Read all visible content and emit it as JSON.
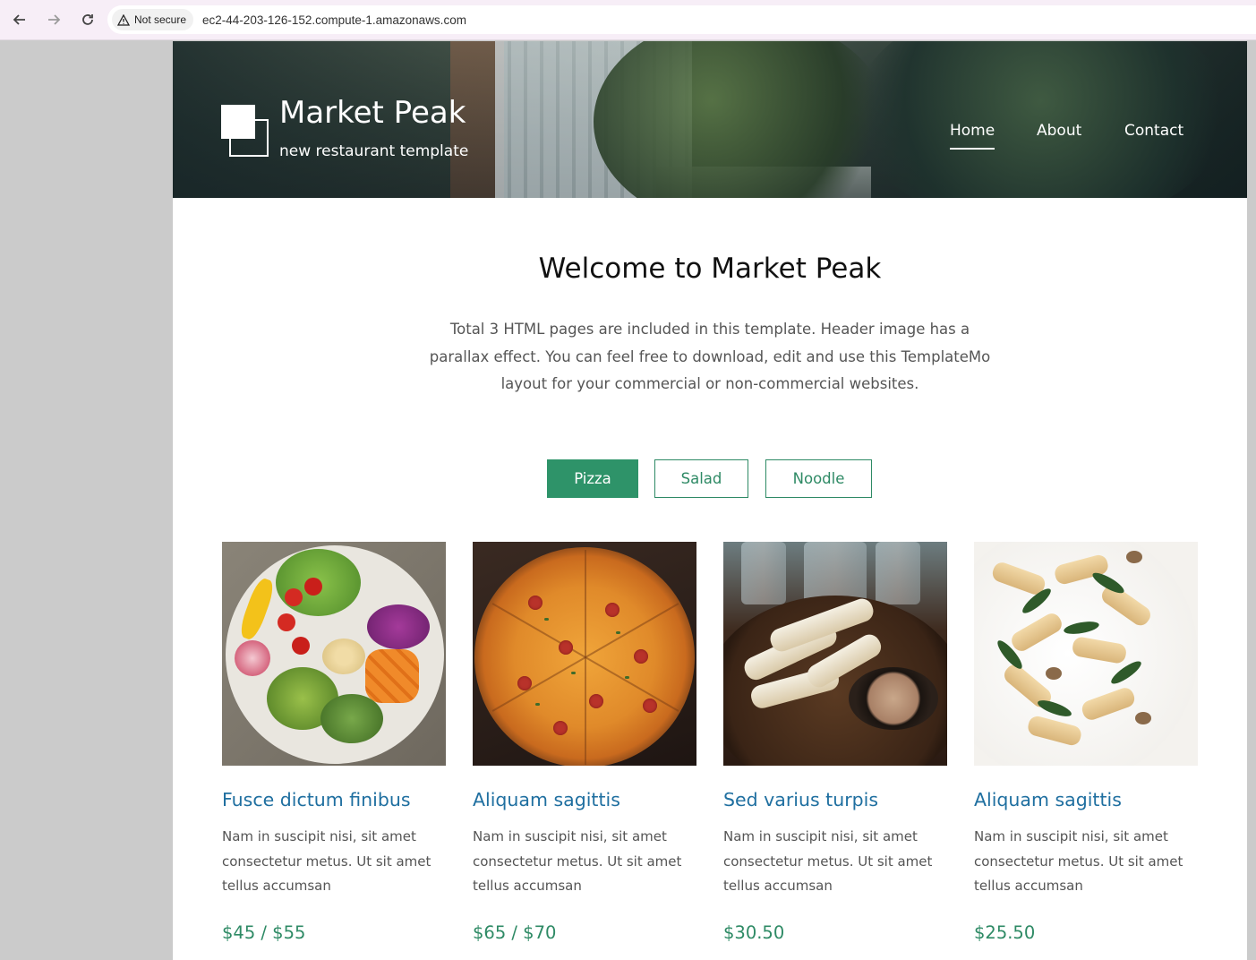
{
  "browser": {
    "back_icon": "arrow-left-icon",
    "forward_icon": "arrow-right-icon",
    "reload_icon": "reload-icon",
    "security_label": "Not secure",
    "url": "ec2-44-203-126-152.compute-1.amazonaws.com"
  },
  "header": {
    "title": "Market Peak",
    "tagline": "new restaurant template",
    "nav": [
      {
        "label": "Home",
        "active": true
      },
      {
        "label": "About",
        "active": false
      },
      {
        "label": "Contact",
        "active": false
      }
    ]
  },
  "welcome": {
    "heading": "Welcome to Market Peak",
    "text": "Total 3 HTML pages are included in this template. Header image has a parallax effect. You can feel free to download, edit and use this TemplateMo layout for your commercial or non-commercial websites."
  },
  "tabs": [
    {
      "label": "Pizza",
      "active": true
    },
    {
      "label": "Salad",
      "active": false
    },
    {
      "label": "Noodle",
      "active": false
    }
  ],
  "items": [
    {
      "title": "Fusce dictum finibus",
      "description": "Nam in suscipit nisi, sit amet consectetur metus. Ut sit amet tellus accumsan",
      "price": "$45 / $55"
    },
    {
      "title": "Aliquam sagittis",
      "description": "Nam in suscipit nisi, sit amet consectetur metus. Ut sit amet tellus accumsan",
      "price": "$65 / $70"
    },
    {
      "title": "Sed varius turpis",
      "description": "Nam in suscipit nisi, sit amet consectetur metus. Ut sit amet tellus accumsan",
      "price": "$30.50"
    },
    {
      "title": "Aliquam sagittis",
      "description": "Nam in suscipit nisi, sit amet consectetur metus. Ut sit amet tellus accumsan",
      "price": "$25.50"
    }
  ],
  "colors": {
    "accent": "#2e9369",
    "title_blue": "#1f6fa0",
    "body_text": "#555555"
  }
}
